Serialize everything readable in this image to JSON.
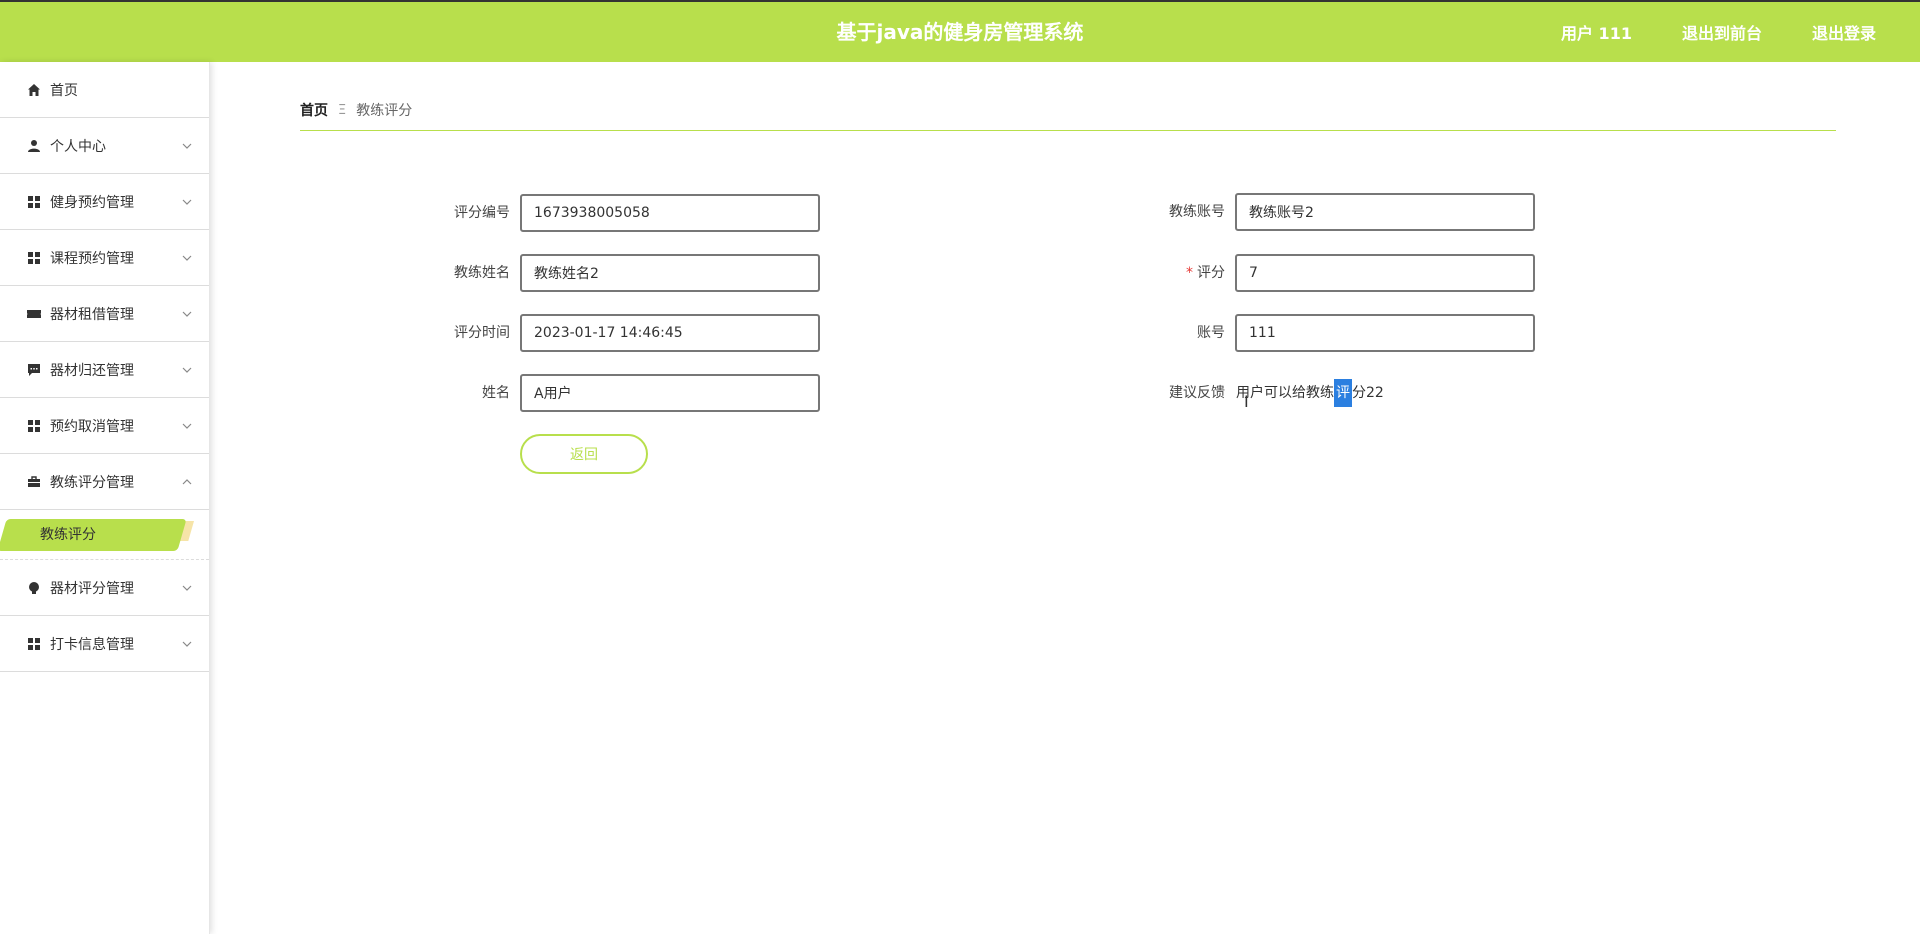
{
  "header": {
    "title": "基于java的健身房管理系统",
    "user": "用户 111",
    "to_front": "退出到前台",
    "logout": "退出登录"
  },
  "sidebar": {
    "items": [
      {
        "label": "首页",
        "icon": "home-icon"
      },
      {
        "label": "个人中心",
        "icon": "user-icon"
      },
      {
        "label": "健身预约管理",
        "icon": "grid-icon"
      },
      {
        "label": "课程预约管理",
        "icon": "grid-icon"
      },
      {
        "label": "器材租借管理",
        "icon": "ticket-icon"
      },
      {
        "label": "器材归还管理",
        "icon": "chat-icon"
      },
      {
        "label": "预约取消管理",
        "icon": "grid-icon"
      },
      {
        "label": "教练评分管理",
        "icon": "briefcase-icon"
      },
      {
        "label": "器材评分管理",
        "icon": "bulb-icon"
      },
      {
        "label": "打卡信息管理",
        "icon": "grid-icon"
      }
    ],
    "active_sub": "教练评分"
  },
  "breadcrumb": {
    "home": "首页",
    "sep": "Ξ",
    "current": "教练评分"
  },
  "form": {
    "rating_no_label": "评分编号",
    "rating_no": "1673938005058",
    "coach_account_label": "教练账号",
    "coach_account": "教练账号2",
    "coach_name_label": "教练姓名",
    "coach_name": "教练姓名2",
    "score_label": "评分",
    "score": "7",
    "rating_time_label": "评分时间",
    "rating_time": "2023-01-17 14:46:45",
    "account_label": "账号",
    "account": "111",
    "name_label": "姓名",
    "name": "A用户",
    "feedback_label": "建议反馈",
    "feedback_part1": "用户可以给教练",
    "feedback_sel": "评",
    "feedback_part2": "分22",
    "back_button": "返回"
  },
  "colors": {
    "accent": "#b8df4c",
    "selection": "#2b7fe0"
  }
}
